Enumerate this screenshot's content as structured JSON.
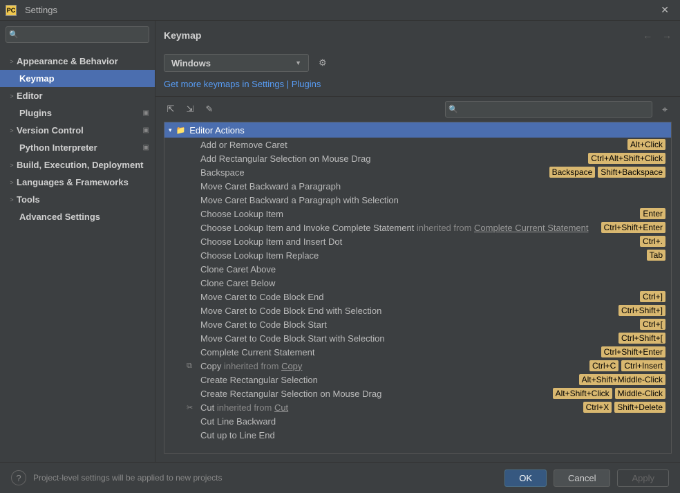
{
  "window": {
    "title": "Settings",
    "app_icon_text": "PC"
  },
  "sidebar": {
    "search_placeholder": "",
    "items": [
      {
        "label": "Appearance & Behavior",
        "expandable": true,
        "bold": true
      },
      {
        "label": "Keymap",
        "expandable": false,
        "bold": true,
        "sub": true,
        "selected": true
      },
      {
        "label": "Editor",
        "expandable": true,
        "bold": true
      },
      {
        "label": "Plugins",
        "expandable": false,
        "bold": true,
        "sub": true,
        "proj": true
      },
      {
        "label": "Version Control",
        "expandable": true,
        "bold": true,
        "proj": true
      },
      {
        "label": "Python Interpreter",
        "expandable": false,
        "bold": true,
        "sub": true,
        "proj": true
      },
      {
        "label": "Build, Execution, Deployment",
        "expandable": true,
        "bold": true
      },
      {
        "label": "Languages & Frameworks",
        "expandable": true,
        "bold": true
      },
      {
        "label": "Tools",
        "expandable": true,
        "bold": true
      },
      {
        "label": "Advanced Settings",
        "expandable": false,
        "bold": true,
        "sub": true
      }
    ]
  },
  "content": {
    "title": "Keymap",
    "keymap_selected": "Windows",
    "link_text": "Get more keymaps in Settings | Plugins",
    "search_placeholder": "",
    "group_header": "Editor Actions",
    "actions": [
      {
        "label": "Add or Remove Caret",
        "shortcuts": [
          "Alt+Click"
        ]
      },
      {
        "label": "Add Rectangular Selection on Mouse Drag",
        "shortcuts": [
          "Ctrl+Alt+Shift+Click"
        ]
      },
      {
        "label": "Backspace",
        "shortcuts": [
          "Backspace",
          "Shift+Backspace"
        ]
      },
      {
        "label": "Move Caret Backward a Paragraph",
        "shortcuts": []
      },
      {
        "label": "Move Caret Backward a Paragraph with Selection",
        "shortcuts": []
      },
      {
        "label": "Choose Lookup Item",
        "shortcuts": [
          "Enter"
        ]
      },
      {
        "label": "Choose Lookup Item and Invoke Complete Statement",
        "inherited_text": "inherited from",
        "inherited_link": "Complete Current Statement",
        "shortcuts": [
          "Ctrl+Shift+Enter"
        ]
      },
      {
        "label": "Choose Lookup Item and Insert Dot",
        "shortcuts": [
          "Ctrl+."
        ]
      },
      {
        "label": "Choose Lookup Item Replace",
        "shortcuts": [
          "Tab"
        ]
      },
      {
        "label": "Clone Caret Above",
        "shortcuts": []
      },
      {
        "label": "Clone Caret Below",
        "shortcuts": []
      },
      {
        "label": "Move Caret to Code Block End",
        "shortcuts": [
          "Ctrl+]"
        ]
      },
      {
        "label": "Move Caret to Code Block End with Selection",
        "shortcuts": [
          "Ctrl+Shift+]"
        ]
      },
      {
        "label": "Move Caret to Code Block Start",
        "shortcuts": [
          "Ctrl+["
        ]
      },
      {
        "label": "Move Caret to Code Block Start with Selection",
        "shortcuts": [
          "Ctrl+Shift+["
        ]
      },
      {
        "label": "Complete Current Statement",
        "shortcuts": [
          "Ctrl+Shift+Enter"
        ]
      },
      {
        "label": "Copy",
        "icon": "copy",
        "inherited_text": "inherited from",
        "inherited_link": "Copy",
        "shortcuts": [
          "Ctrl+C",
          "Ctrl+Insert"
        ]
      },
      {
        "label": "Create Rectangular Selection",
        "shortcuts": [
          "Alt+Shift+Middle-Click"
        ]
      },
      {
        "label": "Create Rectangular Selection on Mouse Drag",
        "shortcuts": [
          "Alt+Shift+Click",
          "Middle-Click"
        ]
      },
      {
        "label": "Cut",
        "icon": "cut",
        "inherited_text": "inherited from",
        "inherited_link": "Cut",
        "shortcuts": [
          "Ctrl+X",
          "Shift+Delete"
        ]
      },
      {
        "label": "Cut Line Backward",
        "shortcuts": []
      },
      {
        "label": "Cut up to Line End",
        "shortcuts": []
      }
    ]
  },
  "footer": {
    "note": "Project-level settings will be applied to new projects",
    "ok": "OK",
    "cancel": "Cancel",
    "apply": "Apply"
  }
}
